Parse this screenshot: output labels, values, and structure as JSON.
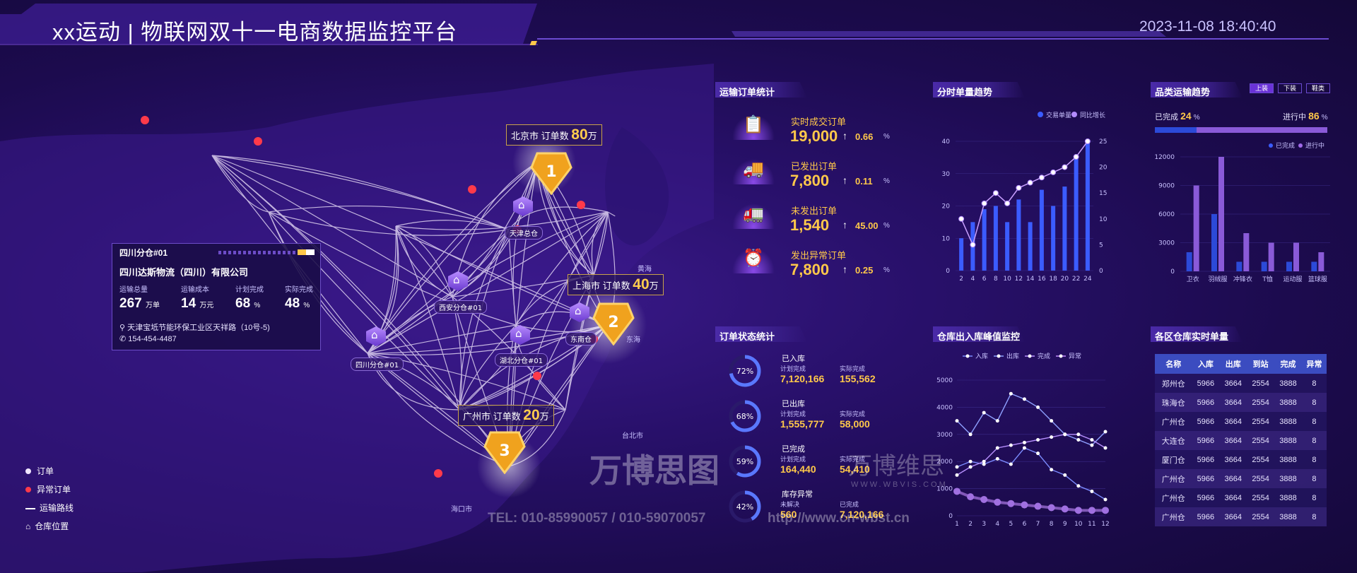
{
  "header": {
    "title": "xx运动 | 物联网双十一电商数据监控平台",
    "datetime": "2023-11-08 18:40:40"
  },
  "map": {
    "cities": [
      {
        "name": "北京市",
        "label": "订单数",
        "value": "80",
        "unit": "万",
        "rank": "1"
      },
      {
        "name": "上海市",
        "label": "订单数",
        "value": "40",
        "unit": "万",
        "rank": "2"
      },
      {
        "name": "广州市",
        "label": "订单数",
        "value": "20",
        "unit": "万",
        "rank": "3"
      }
    ],
    "warehouses": [
      "天津总仓",
      "西安分仓#01",
      "湖北分仓#01",
      "东南仓",
      "四川分仓#01"
    ],
    "place_labels": [
      "黄海",
      "东海",
      "台北市",
      "海口市"
    ]
  },
  "info_card": {
    "header": "四川分仓#01",
    "company": "四川达斯物流（四川）有限公司",
    "stats": [
      {
        "label": "运输总量",
        "value": "267",
        "unit": "万单"
      },
      {
        "label": "运输成本",
        "value": "14",
        "unit": "万元"
      },
      {
        "label": "计划完成",
        "value": "68",
        "unit": "%"
      },
      {
        "label": "实际完成",
        "value": "48",
        "unit": "%"
      }
    ],
    "address": "天津宝坻节能环保工业区天祥路（10号-5)",
    "phone": "154-454-4487"
  },
  "map_legend": [
    {
      "label": "订单",
      "icon": "order-dot-icon",
      "color": "#f0e6ff"
    },
    {
      "label": "异常订单",
      "icon": "abnormal-dot-icon",
      "color": "#ff3a4a"
    },
    {
      "label": "运输路线",
      "icon": "route-line-icon",
      "color": "#ffffff"
    },
    {
      "label": "仓库位置",
      "icon": "warehouse-icon",
      "color": "#ffffff"
    }
  ],
  "order_stats": {
    "title": "运输订单统计",
    "items": [
      {
        "label": "实时成交订单",
        "value": "19,000",
        "arrow": "↑",
        "rate": "0.66",
        "unit": "%",
        "icon": "clipboard-icon"
      },
      {
        "label": "已发出订单",
        "value": "7,800",
        "arrow": "↑",
        "rate": "0.11",
        "unit": "%",
        "icon": "truck-icon"
      },
      {
        "label": "未发出订单",
        "value": "1,540",
        "arrow": "↑",
        "rate": "45.00",
        "unit": "%",
        "icon": "truck-cancel-icon"
      },
      {
        "label": "发出异常订单",
        "value": "7,800",
        "arrow": "↑",
        "rate": "0.25",
        "unit": "%",
        "icon": "alarm-icon"
      }
    ]
  },
  "status_stats": {
    "title": "订单状态统计",
    "items": [
      {
        "pct_label": "72%",
        "pct": 72,
        "name": "已入库",
        "l1": "计划完成",
        "v1": "7,120,166",
        "l2": "实际完成",
        "v2": "155,562"
      },
      {
        "pct_label": "68%",
        "pct": 68,
        "name": "已出库",
        "l1": "计划完成",
        "v1": "1,555,777",
        "l2": "实际完成",
        "v2": "58,000"
      },
      {
        "pct_label": "59%",
        "pct": 59,
        "name": "已完成",
        "l1": "计划完成",
        "v1": "164,440",
        "l2": "实际完成",
        "v2": "54,410"
      },
      {
        "pct_label": "42%",
        "pct": 42,
        "name": "库存异常",
        "l1": "未解决",
        "v1": "560",
        "l2": "已完成",
        "v2": "7,120,166"
      }
    ]
  },
  "hourly": {
    "title": "分时单量趋势",
    "legend": [
      "交易单量",
      "同比增长"
    ],
    "chart_data": {
      "type": "bar",
      "x": [
        "2",
        "4",
        "6",
        "8",
        "10",
        "12",
        "14",
        "16",
        "18",
        "20",
        "22",
        "24"
      ],
      "yticks": [
        "0",
        "10",
        "20",
        "30",
        "40"
      ],
      "y2ticks": [
        "0",
        "5",
        "10",
        "15",
        "20",
        "25"
      ],
      "ylim": [
        0,
        40
      ],
      "y2lim": [
        0,
        25
      ],
      "series": [
        {
          "name": "交易单量",
          "type": "bar",
          "values": [
            10,
            15,
            19,
            20,
            15,
            22,
            15,
            25,
            20,
            26,
            35,
            40
          ]
        },
        {
          "name": "同比增长",
          "type": "line",
          "values": [
            10,
            5,
            13,
            15,
            13,
            16,
            17,
            18,
            19,
            20,
            22,
            25
          ]
        }
      ]
    }
  },
  "category": {
    "title": "品类运输趋势",
    "tabs": [
      "上装",
      "下装",
      "鞋类"
    ],
    "done_label": "已完成",
    "done_value": "24",
    "done_unit": "%",
    "prog_label": "进行中",
    "prog_value": "86",
    "prog_unit": "%",
    "progress_fraction": 0.24,
    "legend": [
      "已完成",
      "进行中"
    ],
    "chart_data": {
      "type": "bar",
      "categories": [
        "卫衣",
        "羽绒服",
        "冲锋衣",
        "T恤",
        "运动服",
        "篮球服"
      ],
      "yticks": [
        "0",
        "3000",
        "6000",
        "9000",
        "12000"
      ],
      "ylim": [
        0,
        12000
      ],
      "series": [
        {
          "name": "已完成",
          "values": [
            2000,
            6000,
            1000,
            1000,
            1000,
            1000
          ]
        },
        {
          "name": "进行中",
          "values": [
            9000,
            12000,
            4000,
            3000,
            3000,
            2000
          ]
        }
      ]
    }
  },
  "peak": {
    "title": "仓库出入库峰值监控",
    "legend": [
      "入库",
      "出库",
      "完成",
      "异常"
    ],
    "chart_data": {
      "type": "line",
      "x": [
        "1",
        "2",
        "3",
        "4",
        "5",
        "6",
        "7",
        "8",
        "9",
        "10",
        "11",
        "12"
      ],
      "yticks": [
        "0",
        "1000",
        "2000",
        "3000",
        "4000",
        "5000"
      ],
      "ylim": [
        0,
        5000
      ],
      "series": [
        {
          "name": "入库",
          "values": [
            1800,
            2000,
            1900,
            2100,
            1900,
            2500,
            2300,
            1700,
            1500,
            1100,
            900,
            600
          ]
        },
        {
          "name": "出库",
          "values": [
            3500,
            3000,
            3800,
            3500,
            4500,
            4300,
            4000,
            3500,
            3000,
            2800,
            2600,
            3100
          ]
        },
        {
          "name": "完成",
          "values": [
            1500,
            1800,
            2000,
            2500,
            2600,
            2700,
            2800,
            2900,
            3000,
            3000,
            2800,
            2500
          ]
        },
        {
          "name": "异常",
          "values": [
            900,
            700,
            600,
            500,
            450,
            400,
            350,
            300,
            250,
            200,
            200,
            200
          ]
        }
      ]
    }
  },
  "warehouse_table": {
    "title": "各区仓库实时单量",
    "headers": [
      "名称",
      "入库",
      "出库",
      "到站",
      "完成",
      "异常"
    ],
    "rows": [
      [
        "郑州仓",
        "5966",
        "3664",
        "2554",
        "3888",
        "8"
      ],
      [
        "珠海仓",
        "5966",
        "3664",
        "2554",
        "3888",
        "8"
      ],
      [
        "广州仓",
        "5966",
        "3664",
        "2554",
        "3888",
        "8"
      ],
      [
        "大连仓",
        "5966",
        "3664",
        "2554",
        "3888",
        "8"
      ],
      [
        "厦门仓",
        "5966",
        "3664",
        "2554",
        "3888",
        "8"
      ],
      [
        "广州仓",
        "5966",
        "3664",
        "2554",
        "3888",
        "8"
      ],
      [
        "广州仓",
        "5966",
        "3664",
        "2554",
        "3888",
        "8"
      ],
      [
        "广州仓",
        "5966",
        "3664",
        "2554",
        "3888",
        "8"
      ]
    ]
  },
  "watermark": {
    "brand1": "万博思图",
    "brand2": "万博维思",
    "url_small": "WWW.WBVIS.COM",
    "tel": "TEL: 010-85990057 / 010-59070057",
    "url": "http://www.cn-wbst.cn"
  }
}
